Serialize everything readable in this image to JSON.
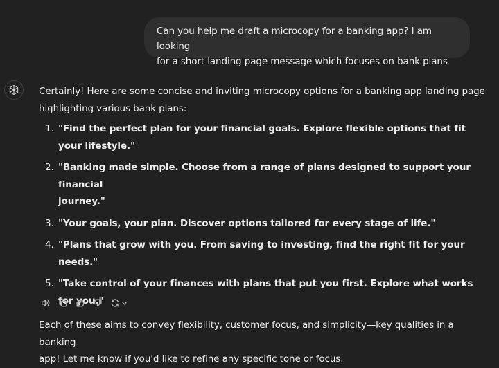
{
  "user_message": {
    "line1": "Can you help me draft a microcopy for a  banking app? I am looking",
    "line2": "for a short landing page message which focuses on bank plans"
  },
  "assistant": {
    "avatar_icon": "openai-logo-icon",
    "intro_line1": "Certainly! Here are some concise and inviting microcopy options for a banking app landing page",
    "intro_line2": "highlighting various bank plans:",
    "options": [
      {
        "num": "1.",
        "lines": [
          "\"Find the perfect plan for your financial goals. Explore flexible options that fit your lifestyle.\""
        ]
      },
      {
        "num": "2.",
        "lines": [
          "\"Banking made simple. Choose from a range of plans designed to support your financial",
          "journey.\""
        ]
      },
      {
        "num": "3.",
        "lines": [
          "\"Your goals, your plan. Discover options tailored for every stage of life.\""
        ]
      },
      {
        "num": "4.",
        "lines": [
          "\"Plans that grow with you. From saving to investing, find the right fit for your needs.\""
        ]
      },
      {
        "num": "5.",
        "lines": [
          "\"Take control of your finances with plans that put you first. Explore what works for you.\""
        ]
      }
    ],
    "outro_line1": "Each of these aims to convey flexibility, customer focus, and simplicity—key qualities in a banking",
    "outro_line2": "app! Let me know if you'd like to refine any specific tone or focus."
  },
  "actions": [
    {
      "name": "read-aloud-icon"
    },
    {
      "name": "copy-icon"
    },
    {
      "name": "thumbs-up-icon"
    },
    {
      "name": "thumbs-down-icon"
    },
    {
      "name": "regenerate-icon"
    }
  ],
  "colors": {
    "background": "#212121",
    "bubble": "#2f2f2f",
    "text": "#ececec",
    "icon": "#b4b4b4"
  }
}
